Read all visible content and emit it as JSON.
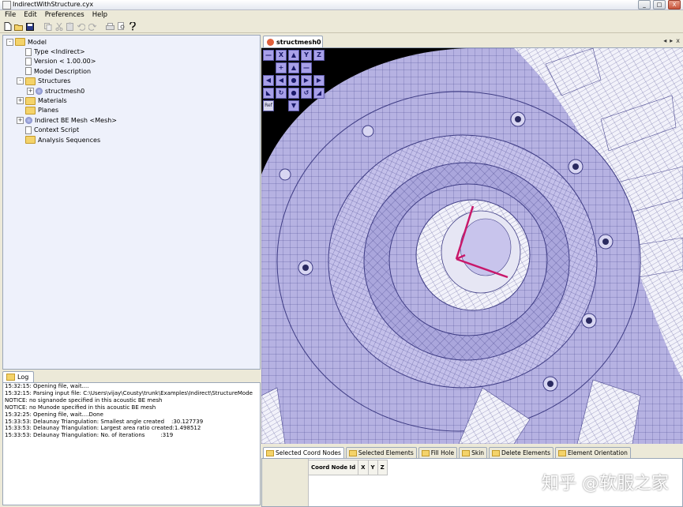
{
  "window": {
    "title": "IndirectWithStructure.cyx",
    "buttons": [
      "_",
      "□",
      "X"
    ]
  },
  "menubar": [
    "File",
    "Edit",
    "Preferences",
    "Help"
  ],
  "toolbar": {
    "icons": [
      "new-icon",
      "open-icon",
      "save-icon",
      "copy-icon",
      "cut-icon",
      "paste-icon",
      "undo-icon",
      "redo-icon",
      "print-icon",
      "print-preview-icon",
      "help-icon"
    ]
  },
  "tree": {
    "items": [
      {
        "label": "Model",
        "level": 0,
        "icon": "folder",
        "expander": "-"
      },
      {
        "label": "Type <Indirect>",
        "level": 1,
        "icon": "doc",
        "expander": ""
      },
      {
        "label": "Version < 1.00.00>",
        "level": 1,
        "icon": "doc",
        "expander": ""
      },
      {
        "label": "Model Description",
        "level": 1,
        "icon": "doc",
        "expander": ""
      },
      {
        "label": "Structures",
        "level": 1,
        "icon": "folder",
        "expander": "-"
      },
      {
        "label": "structmesh0",
        "level": 2,
        "icon": "mesh",
        "expander": "+"
      },
      {
        "label": "Materials",
        "level": 1,
        "icon": "folder",
        "expander": "+"
      },
      {
        "label": "Planes",
        "level": 1,
        "icon": "folder",
        "expander": ""
      },
      {
        "label": "Indirect BE Mesh <Mesh>",
        "level": 1,
        "icon": "mesh",
        "expander": "+"
      },
      {
        "label": "Context Script",
        "level": 1,
        "icon": "doc",
        "expander": ""
      },
      {
        "label": "Analysis Sequences",
        "level": 1,
        "icon": "folder",
        "expander": ""
      }
    ]
  },
  "log": {
    "tab_label": "Log",
    "lines": [
      "15:32:15: Opening file, wait....",
      "15:32:15: Parsing input file: C:\\Users\\vijay\\Cousty\\trunk\\Examples\\Indirect\\StructureMode",
      "NOTICE: no signanode specified in this acoustic BE mesh",
      "NOTICE: no Munode specified in this acoustic BE mesh",
      "15:32:25: Opening file, wait....Done",
      "15:33:53: Delaunay Triangulation: Smallest angle created    :30.127739",
      "15:33:53: Delaunay Triangulation: Largest area ratio created:1.498512",
      "15:33:53: Delaunay Triangulation: No. of iterations         :319"
    ]
  },
  "viewer": {
    "tab_label": "structmesh0",
    "controls": [
      "◂",
      "▸",
      "x"
    ],
    "palette_rows": [
      [
        "—",
        "X",
        "▲",
        "Y",
        "Z"
      ],
      [
        "+",
        "▲",
        "—"
      ],
      [
        "◀",
        "◀",
        "●",
        "▶",
        "▶"
      ],
      [
        "◣",
        "↻",
        "●",
        "↺",
        "◢"
      ],
      [
        "Ref",
        "▼"
      ]
    ]
  },
  "bottom": {
    "tabs": [
      "Selected Coord Nodes",
      "Selected Elements",
      "Fill Hole",
      "Skin",
      "Delete Elements",
      "Element Orientation"
    ],
    "active_tab": 0,
    "columns": [
      "Coord Node Id",
      "X",
      "Y",
      "Z"
    ]
  },
  "watermark": "知乎 @软服之家",
  "colors": {
    "mesh_fill": "#b8b4e4",
    "mesh_line": "#4a4890",
    "axis": "#c8186a",
    "panel_bg": "#eef1fb"
  }
}
